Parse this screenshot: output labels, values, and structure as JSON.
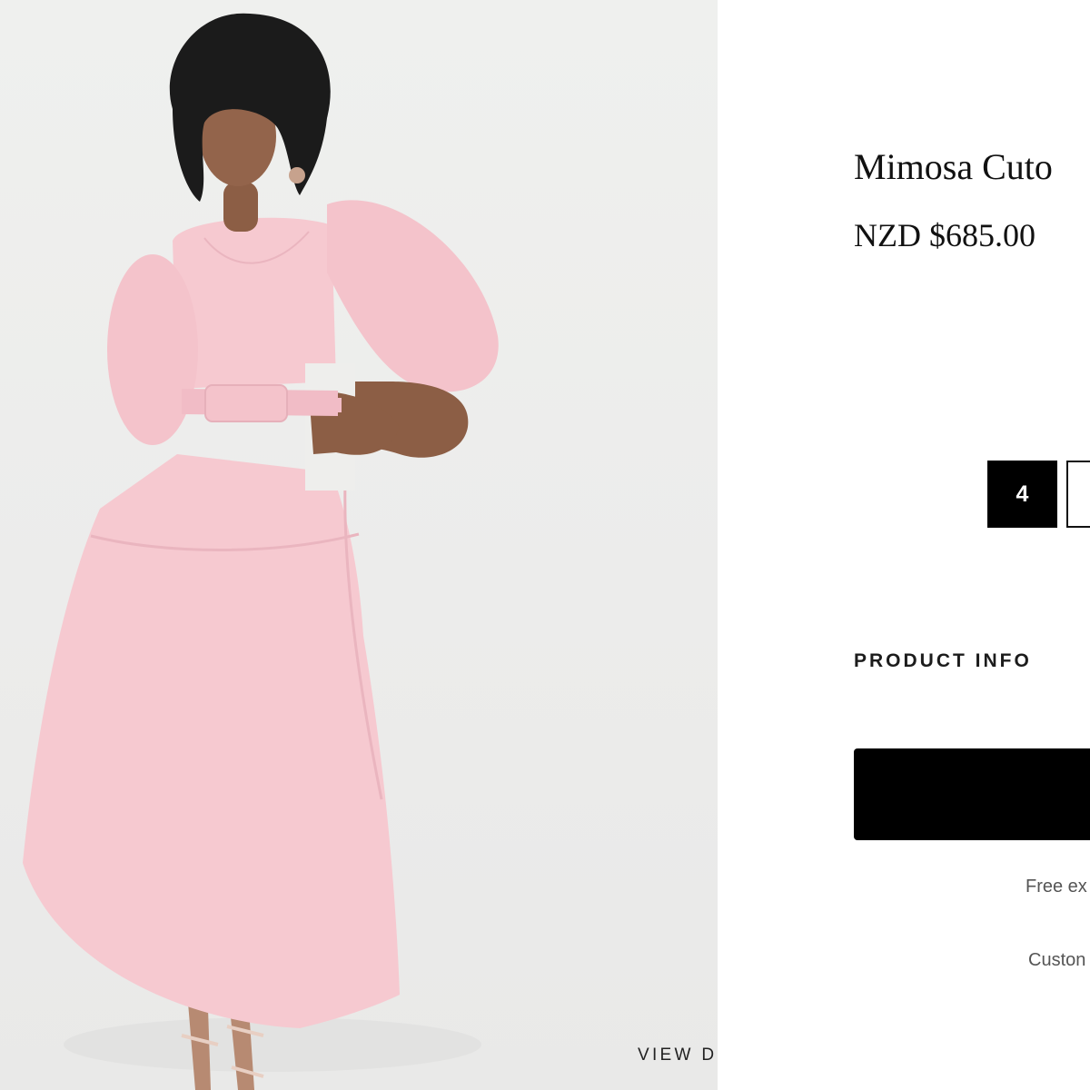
{
  "photo": {
    "alt": "Model wearing pink puff-sleeve cutout midi dress",
    "view_details_label": "VIEW DETAILS"
  },
  "product": {
    "title": "Mimosa Cuto",
    "price": "NZD $685.00"
  },
  "sizes": {
    "selected_label": "4",
    "next_label": ""
  },
  "product_info": {
    "heading": "PRODUCT INFO"
  },
  "purchase": {
    "add_button_label": "",
    "shipping_note": "Free ex",
    "customer_note": "Custon"
  },
  "colors": {
    "dress": "#f6c9d0",
    "button": "#000000",
    "background": "#eeeeec"
  }
}
